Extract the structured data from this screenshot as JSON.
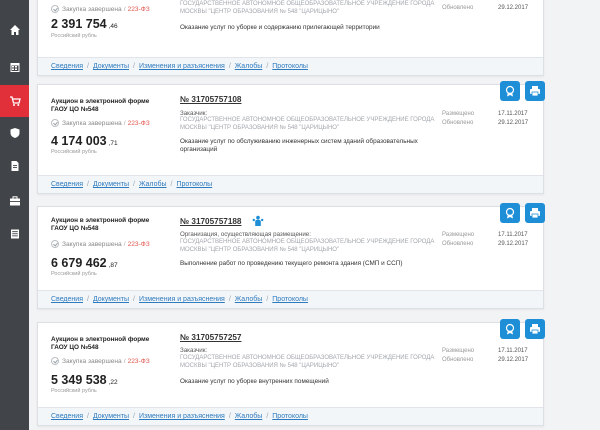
{
  "sidebar": {
    "items": [
      {
        "icon": "home-icon"
      },
      {
        "icon": "calendar-icon"
      },
      {
        "icon": "cart-icon",
        "active": true
      },
      {
        "icon": "shield-icon"
      },
      {
        "icon": "document-icon"
      },
      {
        "icon": "briefcase-icon"
      },
      {
        "icon": "list-icon"
      }
    ]
  },
  "labels": {
    "published": "Размещено",
    "updated": "Обновлено",
    "currency": "Российский рубль",
    "law": "223-ФЗ",
    "status": "Закупка завершена"
  },
  "cards": [
    {
      "price_main": "2 391 754",
      "price_kop": ",46",
      "customer": "ГОСУДАРСТВЕННОЕ АВТОНОМНОЕ ОБЩЕОБРАЗОВАТЕЛЬНОЕ УЧРЕЖДЕНИЕ ГОРОДА МОСКВЫ \"ЦЕНТР ОБРАЗОВАНИЯ № 548 \"ЦАРИЦЫНО\"",
      "subject": "Оказание услуг по уборке и содержанию прилегающей территории",
      "date_updated": "29.12.2017",
      "links": [
        "Сведения",
        "Документы",
        "Изменения и разъяснения",
        "Жалобы",
        "Протоколы"
      ]
    },
    {
      "proc_type": "Аукцион в электронной форме",
      "org_short": "ГАОУ ЦО №548",
      "price_main": "4 174 003",
      "price_kop": ",71",
      "purchase_no": "№ 31705757108",
      "role_label": "Заказчик:",
      "customer": "ГОСУДАРСТВЕННОЕ АВТОНОМНОЕ ОБЩЕОБРАЗОВАТЕЛЬНОЕ УЧРЕЖДЕНИЕ ГОРОДА МОСКВЫ \"ЦЕНТР ОБРАЗОВАНИЯ № 548 \"ЦАРИЦЫНО\"",
      "subject": "Оказание услуг по обслуживанию инженерных систем зданий образовательных организаций",
      "date_published": "17.11.2017",
      "date_updated": "29.12.2017",
      "links": [
        "Сведения",
        "Документы",
        "Жалобы",
        "Протоколы"
      ]
    },
    {
      "proc_type": "Аукцион в электронной форме",
      "org_short": "ГАОУ ЦО №548",
      "price_main": "6 679 462",
      "price_kop": ",87",
      "purchase_no": "№ 31705757188",
      "role_label": "Организация, осуществляющая размещение:",
      "customer": "ГОСУДАРСТВЕННОЕ АВТОНОМНОЕ ОБЩЕОБРАЗОВАТЕЛЬНОЕ УЧРЕЖДЕНИЕ ГОРОДА МОСКВЫ \"ЦЕНТР ОБРАЗОВАНИЯ № 548 \"ЦАРИЦЫНО\"",
      "subject": "Выполнение работ по проведению текущего ремонта здания (СМП и ССП)",
      "date_published": "17.11.2017",
      "date_updated": "29.12.2017",
      "links": [
        "Сведения",
        "Документы",
        "Изменения и разъяснения",
        "Жалобы",
        "Протоколы"
      ]
    },
    {
      "proc_type": "Аукцион в электронной форме",
      "org_short": "ГАОУ ЦО №548",
      "price_main": "5 349 538",
      "price_kop": ",22",
      "purchase_no": "№ 31705757257",
      "role_label": "Заказчик:",
      "customer": "ГОСУДАРСТВЕННОЕ АВТОНОМНОЕ ОБЩЕОБРАЗОВАТЕЛЬНОЕ УЧРЕЖДЕНИЕ ГОРОДА МОСКВЫ \"ЦЕНТР ОБРАЗОВАНИЯ № 548 \"ЦАРИЦЫНО\"",
      "subject": "Оказание услуг по уборке внутренних помещений",
      "date_published": "17.11.2017",
      "date_updated": "29.12.2017",
      "links": [
        "Сведения",
        "Документы",
        "Изменения и разъяснения",
        "Жалобы",
        "Протоколы"
      ]
    }
  ],
  "colors": {
    "sidebar_bg": "#414549",
    "sidebar_active": "#e2303a",
    "accent_blue": "#1e8fd6",
    "law_red": "#e0554d",
    "link_blue": "#2e7bbf"
  }
}
